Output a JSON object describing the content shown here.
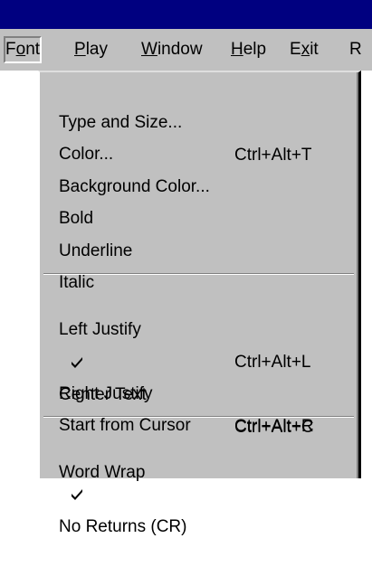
{
  "menubar": {
    "items": [
      {
        "pre": "F",
        "u": "o",
        "post": "nt"
      },
      {
        "pre": "",
        "u": "P",
        "post": "lay"
      },
      {
        "pre": "",
        "u": "W",
        "post": "indow"
      },
      {
        "pre": "",
        "u": "H",
        "post": "elp"
      },
      {
        "pre": "E",
        "u": "x",
        "post": "it"
      },
      {
        "pre": "",
        "u": "",
        "post": "R"
      }
    ]
  },
  "font_menu": {
    "items": [
      {
        "label": "Type and Size...",
        "shortcut": "Ctrl+Alt+T",
        "checked": false
      },
      {
        "label": "Color...",
        "shortcut": "",
        "checked": false
      },
      {
        "label": "Background Color...",
        "shortcut": "",
        "checked": false
      },
      {
        "label": "Bold",
        "shortcut": "",
        "checked": false
      },
      {
        "label": "Underline",
        "shortcut": "",
        "checked": false
      },
      {
        "label": "Italic",
        "shortcut": "",
        "checked": false
      },
      {
        "label": "Left Justify",
        "shortcut": "Ctrl+Alt+L",
        "checked": false
      },
      {
        "label": "Center Text",
        "shortcut": "Ctrl+Alt+C",
        "checked": true
      },
      {
        "label": "Right Justify",
        "shortcut": "Ctrl+Alt+R",
        "checked": false
      },
      {
        "label": "Start from Cursor",
        "shortcut": "",
        "checked": false
      },
      {
        "label": "Word Wrap",
        "shortcut": "",
        "checked": false
      },
      {
        "label": "No Returns (CR)",
        "shortcut": "",
        "checked": true
      }
    ]
  },
  "icons": {
    "check": "checkmark-icon"
  }
}
